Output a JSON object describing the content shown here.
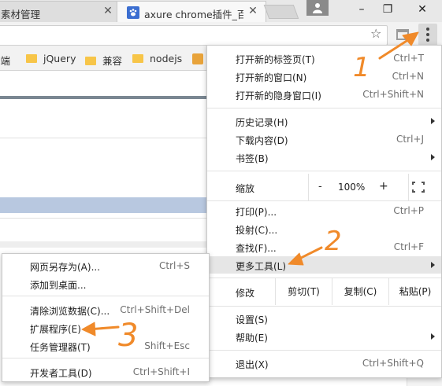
{
  "colors": {
    "annotation": "#f08a2a",
    "menu_highlight": "#e6e6e6",
    "page_band": "#b8c8e0"
  },
  "tabs": [
    {
      "title": "素材管理",
      "close_icon": "close-icon"
    },
    {
      "title": "axure chrome插件_百度",
      "favicon": "baidu-paw-icon",
      "close_icon": "close-icon"
    }
  ],
  "window_controls": {
    "minimize": "–",
    "maximize": "❐",
    "close": "✕"
  },
  "toolbar": {
    "star_icon": "☆"
  },
  "bookmarks": [
    {
      "label": "前端"
    },
    {
      "label": "jQuery"
    },
    {
      "label": "兼容"
    },
    {
      "label": "nodejs"
    }
  ],
  "menu": {
    "items_top": [
      {
        "label": "打开新的标签页(T)",
        "shortcut": "Ctrl+T"
      },
      {
        "label": "打开新的窗口(N)",
        "shortcut": "Ctrl+N"
      },
      {
        "label": "打开新的隐身窗口(I)",
        "shortcut": "Ctrl+Shift+N"
      }
    ],
    "items_history": [
      {
        "label": "历史记录(H)",
        "shortcut": ""
      },
      {
        "label": "下载内容(D)",
        "shortcut": "Ctrl+J"
      },
      {
        "label": "书签(B)",
        "shortcut": ""
      }
    ],
    "zoom": {
      "label": "缩放",
      "minus": "-",
      "value": "100%",
      "plus": "+"
    },
    "items_tools": [
      {
        "label": "打印(P)...",
        "shortcut": "Ctrl+P"
      },
      {
        "label": "投射(C)...",
        "shortcut": ""
      },
      {
        "label": "查找(F)...",
        "shortcut": "Ctrl+F"
      },
      {
        "label": "更多工具(L)",
        "shortcut": ""
      }
    ],
    "edit": {
      "label": "修改",
      "cut": "剪切(T)",
      "copy": "复制(C)",
      "paste": "粘贴(P)"
    },
    "items_settings": [
      {
        "label": "设置(S)",
        "shortcut": ""
      },
      {
        "label": "帮助(E)",
        "shortcut": ""
      }
    ],
    "exit": {
      "label": "退出(X)",
      "shortcut": "Ctrl+Shift+Q"
    }
  },
  "submenu": {
    "items": [
      {
        "label": "网页另存为(A)...",
        "shortcut": "Ctrl+S"
      },
      {
        "label": "添加到桌面...",
        "shortcut": ""
      },
      {
        "label": "清除浏览数据(C)...",
        "shortcut": "Ctrl+Shift+Del"
      },
      {
        "label": "扩展程序(E)",
        "shortcut": ""
      },
      {
        "label": "任务管理器(T)",
        "shortcut": "Shift+Esc"
      },
      {
        "label": "开发者工具(D)",
        "shortcut": "Ctrl+Shift+I"
      }
    ]
  },
  "annotations": {
    "step1": "1",
    "step2": "2",
    "step3": "3"
  }
}
